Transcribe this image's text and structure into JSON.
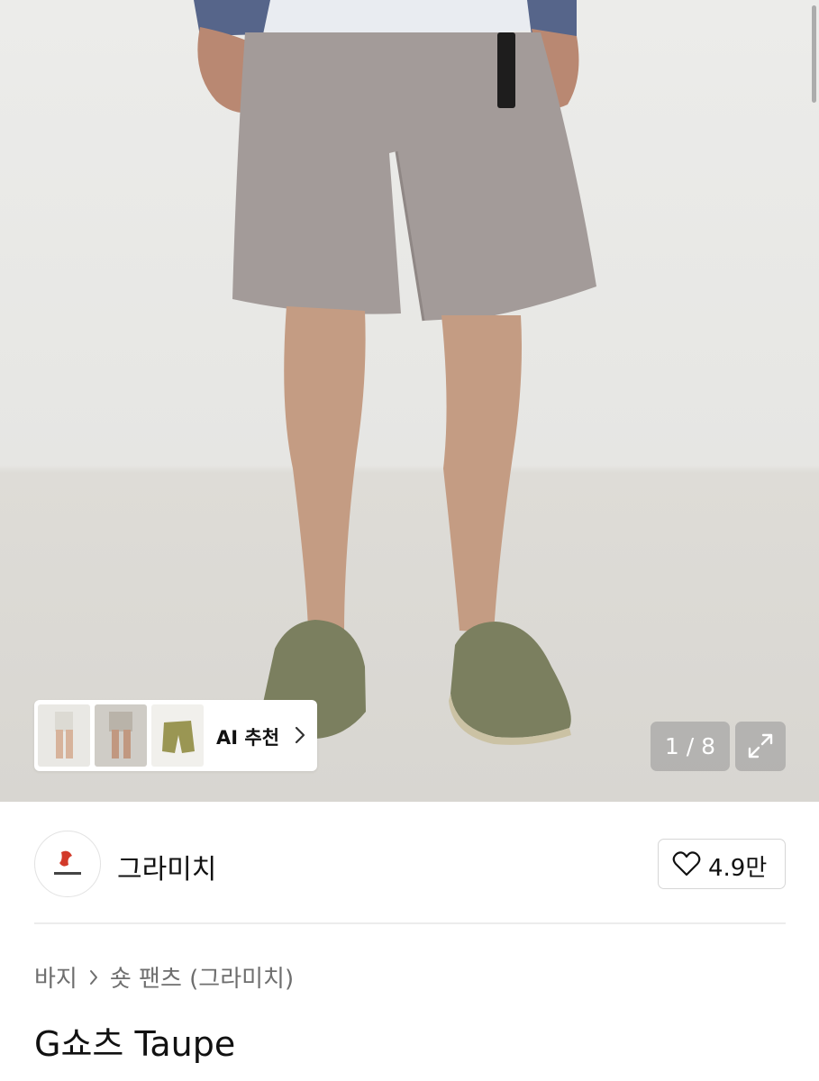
{
  "hero": {
    "counter": "1 / 8",
    "ai_recommend_label": "AI 추천"
  },
  "brand": {
    "name": "그라미치",
    "likes": "4.9만"
  },
  "breadcrumb": {
    "items": [
      "바지",
      "숏 팬츠 (그라미치)"
    ]
  },
  "product": {
    "title": "G쇼츠 Taupe"
  },
  "icons": {
    "expand": "expand-icon",
    "heart": "heart-icon",
    "chevron": "chevron-right-icon"
  },
  "colors": {
    "pants": "#a39b99",
    "accent_logo": "#d23a2a"
  }
}
